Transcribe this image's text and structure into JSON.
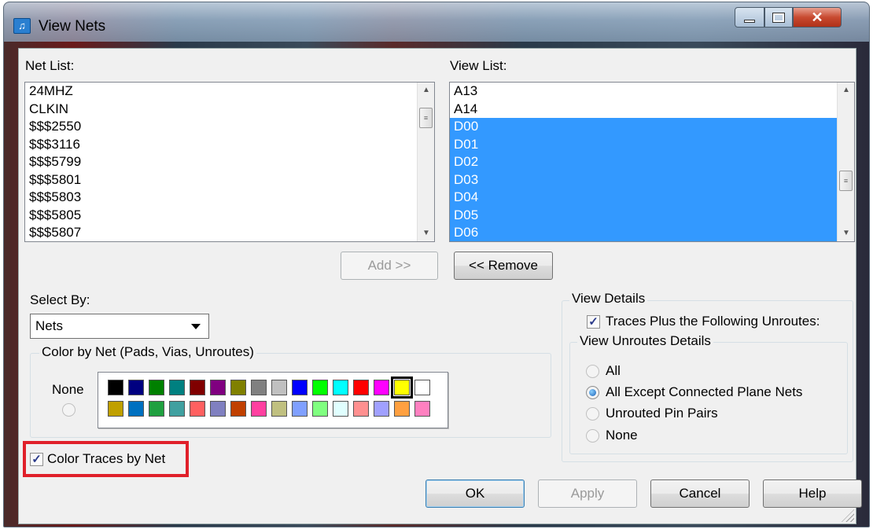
{
  "window": {
    "title": "View Nets"
  },
  "net_list": {
    "label": "Net List:",
    "items": [
      "24MHZ",
      "CLKIN",
      "$$$2550",
      "$$$3116",
      "$$$5799",
      "$$$5801",
      "$$$5803",
      "$$$5805",
      "$$$5807"
    ]
  },
  "view_list": {
    "label": "View List:",
    "items": [
      "A13",
      "A14",
      "D00",
      "D01",
      "D02",
      "D03",
      "D04",
      "D05",
      "D06"
    ],
    "selected": [
      "D00",
      "D01",
      "D02",
      "D03",
      "D04",
      "D05",
      "D06"
    ]
  },
  "buttons": {
    "add": "Add >>",
    "remove": "<< Remove",
    "ok": "OK",
    "apply": "Apply",
    "cancel": "Cancel",
    "help": "Help"
  },
  "select_by": {
    "label": "Select By:",
    "value": "Nets"
  },
  "color_by_net": {
    "label": "Color by Net (Pads, Vias, Unroutes)",
    "none_label": "None",
    "row1": [
      "#000000",
      "#000080",
      "#008000",
      "#008080",
      "#800000",
      "#800080",
      "#808000",
      "#808080",
      "#c0c0c0",
      "#0000ff",
      "#00ff00",
      "#00ffff",
      "#ff0000",
      "#ff00ff",
      "#ffff00",
      "#ffffff"
    ],
    "row2": [
      "#c0a000",
      "#0070c0",
      "#20a040",
      "#40a0a0",
      "#ff6060",
      "#8080c0",
      "#c04000",
      "#ff40a0",
      "#c0c080",
      "#80a0ff",
      "#80ff80",
      "#e0ffff",
      "#ff9090",
      "#a0a0ff",
      "#ffa040",
      "#ff80c0"
    ],
    "selected_color": "#ffff00"
  },
  "color_traces": {
    "label": "Color Traces by Net",
    "checked": true
  },
  "view_details": {
    "label": "View Details",
    "traces_label": "Traces Plus the Following Unroutes:",
    "traces_checked": true,
    "unroutes_label": "View Unroutes Details",
    "options": [
      "All",
      "All Except Connected Plane Nets",
      "Unrouted Pin Pairs",
      "None"
    ],
    "selected": "All Except Connected Plane Nets"
  },
  "colors": {
    "selection": "#3399ff",
    "highlight": "#e0202a"
  }
}
